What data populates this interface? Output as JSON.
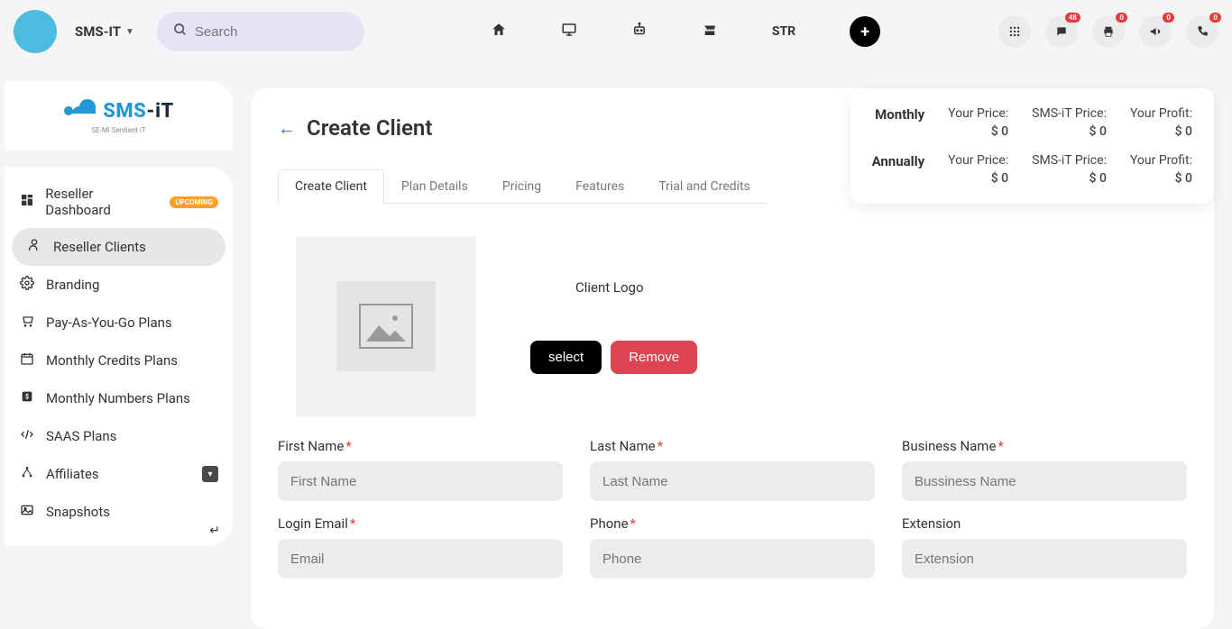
{
  "header": {
    "brand": "SMS-IT",
    "search_placeholder": "Search",
    "str_label": "STR"
  },
  "badges": {
    "chat": "48",
    "print": "0",
    "announce": "0",
    "phone": "0"
  },
  "sidebar": {
    "logo_line1": "SMS-iT",
    "logo_line2": "SE-Mi Sentient iT",
    "items": [
      {
        "label": "Reseller Dashboard",
        "badge": "UPCOMING"
      },
      {
        "label": "Reseller Clients"
      },
      {
        "label": "Branding"
      },
      {
        "label": "Pay-As-You-Go Plans"
      },
      {
        "label": "Monthly Credits Plans"
      },
      {
        "label": "Monthly Numbers Plans"
      },
      {
        "label": "SAAS Plans"
      },
      {
        "label": "Affiliates"
      },
      {
        "label": "Snapshots"
      }
    ]
  },
  "page": {
    "title": "Create Client",
    "tabs": [
      "Create Client",
      "Plan Details",
      "Pricing",
      "Features",
      "Trial and Credits"
    ],
    "client_logo_label": "Client Logo",
    "select_btn": "select",
    "remove_btn": "Remove"
  },
  "pricing": {
    "monthly_label": "Monthly",
    "annually_label": "Annually",
    "your_price_label": "Your Price:",
    "smsit_price_label": "SMS-iT Price:",
    "your_profit_label": "Your Profit:",
    "monthly_your_price": "$ 0",
    "monthly_smsit_price": "$ 0",
    "monthly_your_profit": "$ 0",
    "annually_your_price": "$ 0",
    "annually_smsit_price": "$ 0",
    "annually_your_profit": "$ 0"
  },
  "form": {
    "first_name_label": "First Name",
    "first_name_placeholder": "First Name",
    "last_name_label": "Last Name",
    "last_name_placeholder": "Last Name",
    "business_name_label": "Business Name",
    "business_name_placeholder": "Bussiness Name",
    "login_email_label": "Login Email",
    "login_email_placeholder": "Email",
    "phone_label": "Phone",
    "phone_placeholder": "Phone",
    "extension_label": "Extension",
    "extension_placeholder": "Extension"
  }
}
